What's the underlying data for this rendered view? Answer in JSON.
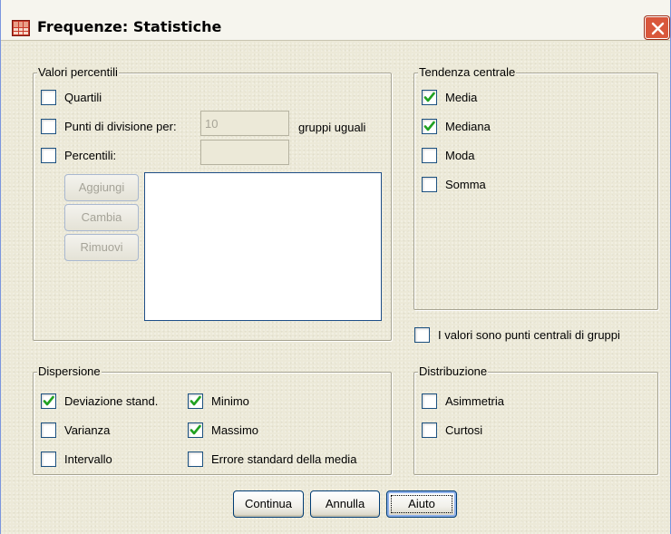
{
  "window": {
    "title": "Frequenze: Statistiche"
  },
  "percentile_values": {
    "legend": "Valori percentili",
    "quartiles_label": "Quartili",
    "cut_points_label": "Punti di divisione per:",
    "cut_points_value": "10",
    "equal_groups_label": "gruppi uguali",
    "percentiles_label": "Percentili:",
    "percentiles_value": "",
    "add_label": "Aggiungi",
    "change_label": "Cambia",
    "remove_label": "Rimuovi"
  },
  "central_tendency": {
    "legend": "Tendenza centrale",
    "mean_label": "Media",
    "median_label": "Mediana",
    "mode_label": "Moda",
    "sum_label": "Somma"
  },
  "group_midpoints_label": "I valori sono punti centrali di gruppi",
  "dispersion": {
    "legend": "Dispersione",
    "std_dev_label": "Deviazione stand.",
    "minimum_label": "Minimo",
    "variance_label": "Varianza",
    "maximum_label": "Massimo",
    "range_label": "Intervallo",
    "se_mean_label": "Errore standard della media"
  },
  "distribution": {
    "legend": "Distribuzione",
    "skewness_label": "Asimmetria",
    "kurtosis_label": "Curtosi"
  },
  "buttons": {
    "continue_label": "Continua",
    "cancel_label": "Annulla",
    "help_label": "Aiuto"
  },
  "states": {
    "quartiles": false,
    "cut_points": false,
    "percentiles": false,
    "mean": true,
    "median": true,
    "mode": false,
    "sum": false,
    "group_midpoints": false,
    "std_dev": true,
    "minimum": true,
    "variance": false,
    "maximum": true,
    "range": false,
    "se_mean": false,
    "skewness": false,
    "kurtosis": false
  },
  "icons": {
    "app": "statistics-table-icon",
    "close": "close-icon",
    "check": "checkmark-icon"
  },
  "colors": {
    "dialog_bg": "#ece9d8",
    "close_button": "#d9573c",
    "checkbox_border": "#1c5180",
    "checkmark": "#21a121",
    "button_border": "#003c74",
    "disabled_text": "#a5a398"
  }
}
